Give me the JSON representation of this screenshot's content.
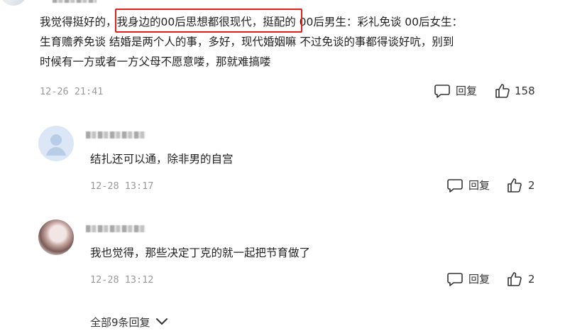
{
  "main_comment": {
    "lines": [
      "我觉得挺好的，我身边的00后思想都很现代，挺配的 00后男生：彩礼免谈 00后女生：",
      "生育赡养免谈 结婚是两个人的事，多好，现代婚姻嘛 不过免谈的事都得谈好吭，别到",
      "时候有一方或者一方父母不愿意喽，那就难搞喽"
    ],
    "time": "12-26 21:41",
    "reply_label": "回复",
    "like_count": "158"
  },
  "replies": [
    {
      "text": "结扎还可以通，除非男的自宫",
      "time": "12-28 13:17",
      "reply_label": "回复",
      "like_count": "2"
    },
    {
      "text": "我也觉得，那些决定丁克的就一起把节育做了",
      "time": "12-28 13:12",
      "reply_label": "回复",
      "like_count": "2"
    }
  ],
  "expand_label": "全部9条回复",
  "icons": {
    "comment": "comment-bubble-icon",
    "like": "thumbs-up-icon",
    "expand": "chevron-down-icon"
  },
  "colors": {
    "highlight": "#e0211b",
    "meta": "#999999",
    "text": "#222222"
  }
}
